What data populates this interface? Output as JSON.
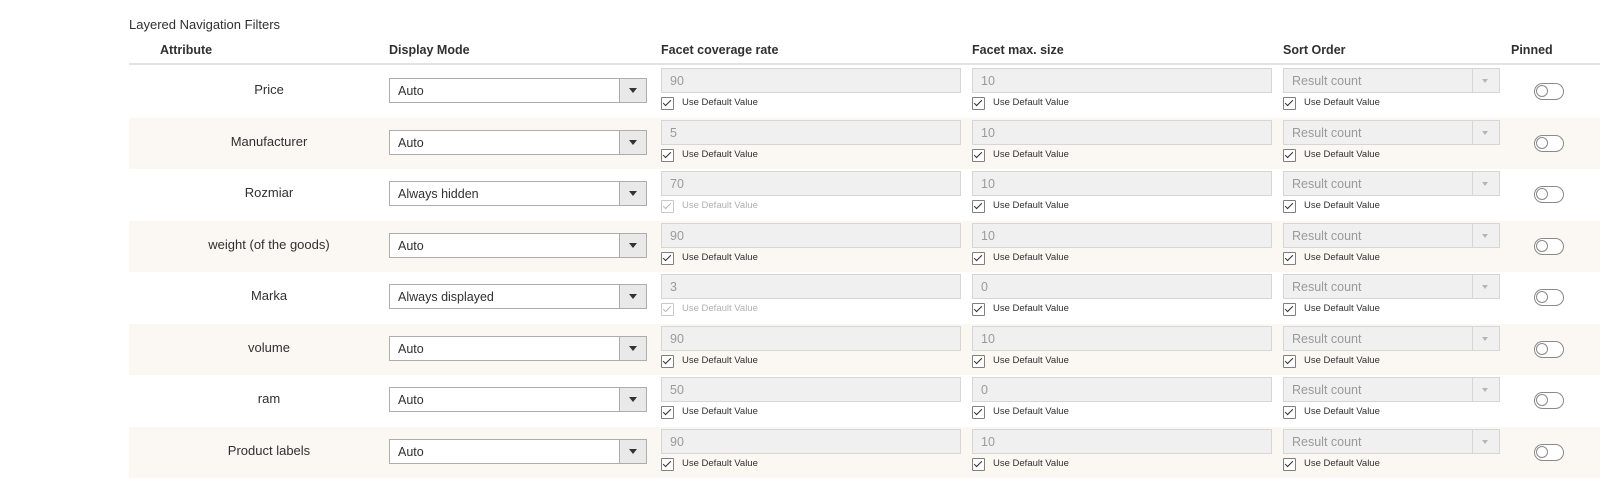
{
  "section_title": "Layered Navigation Filters",
  "columns": {
    "attribute": "Attribute",
    "display_mode": "Display Mode",
    "facet_coverage_rate": "Facet coverage rate",
    "facet_max_size": "Facet max. size",
    "sort_order": "Sort Order",
    "pinned": "Pinned"
  },
  "checkbox_label": "Use Default Value",
  "rows": [
    {
      "attribute": "Price",
      "display_mode": "Auto",
      "coverage": "90",
      "coverage_default_disabled": false,
      "max_size": "10",
      "sort_order": "Result count",
      "pinned": false
    },
    {
      "attribute": "Manufacturer",
      "display_mode": "Auto",
      "coverage": "5",
      "coverage_default_disabled": false,
      "max_size": "10",
      "sort_order": "Result count",
      "pinned": false
    },
    {
      "attribute": "Rozmiar",
      "display_mode": "Always hidden",
      "coverage": "70",
      "coverage_default_disabled": true,
      "max_size": "10",
      "sort_order": "Result count",
      "pinned": false
    },
    {
      "attribute": "weight (of the goods)",
      "display_mode": "Auto",
      "coverage": "90",
      "coverage_default_disabled": false,
      "max_size": "10",
      "sort_order": "Result count",
      "pinned": false
    },
    {
      "attribute": "Marka",
      "display_mode": "Always displayed",
      "coverage": "3",
      "coverage_default_disabled": true,
      "max_size": "0",
      "sort_order": "Result count",
      "pinned": false
    },
    {
      "attribute": "volume",
      "display_mode": "Auto",
      "coverage": "90",
      "coverage_default_disabled": false,
      "max_size": "10",
      "sort_order": "Result count",
      "pinned": false
    },
    {
      "attribute": "ram",
      "display_mode": "Auto",
      "coverage": "50",
      "coverage_default_disabled": false,
      "max_size": "0",
      "sort_order": "Result count",
      "pinned": false
    },
    {
      "attribute": "Product labels",
      "display_mode": "Auto",
      "coverage": "90",
      "coverage_default_disabled": false,
      "max_size": "10",
      "sort_order": "Result count",
      "pinned": false
    }
  ]
}
